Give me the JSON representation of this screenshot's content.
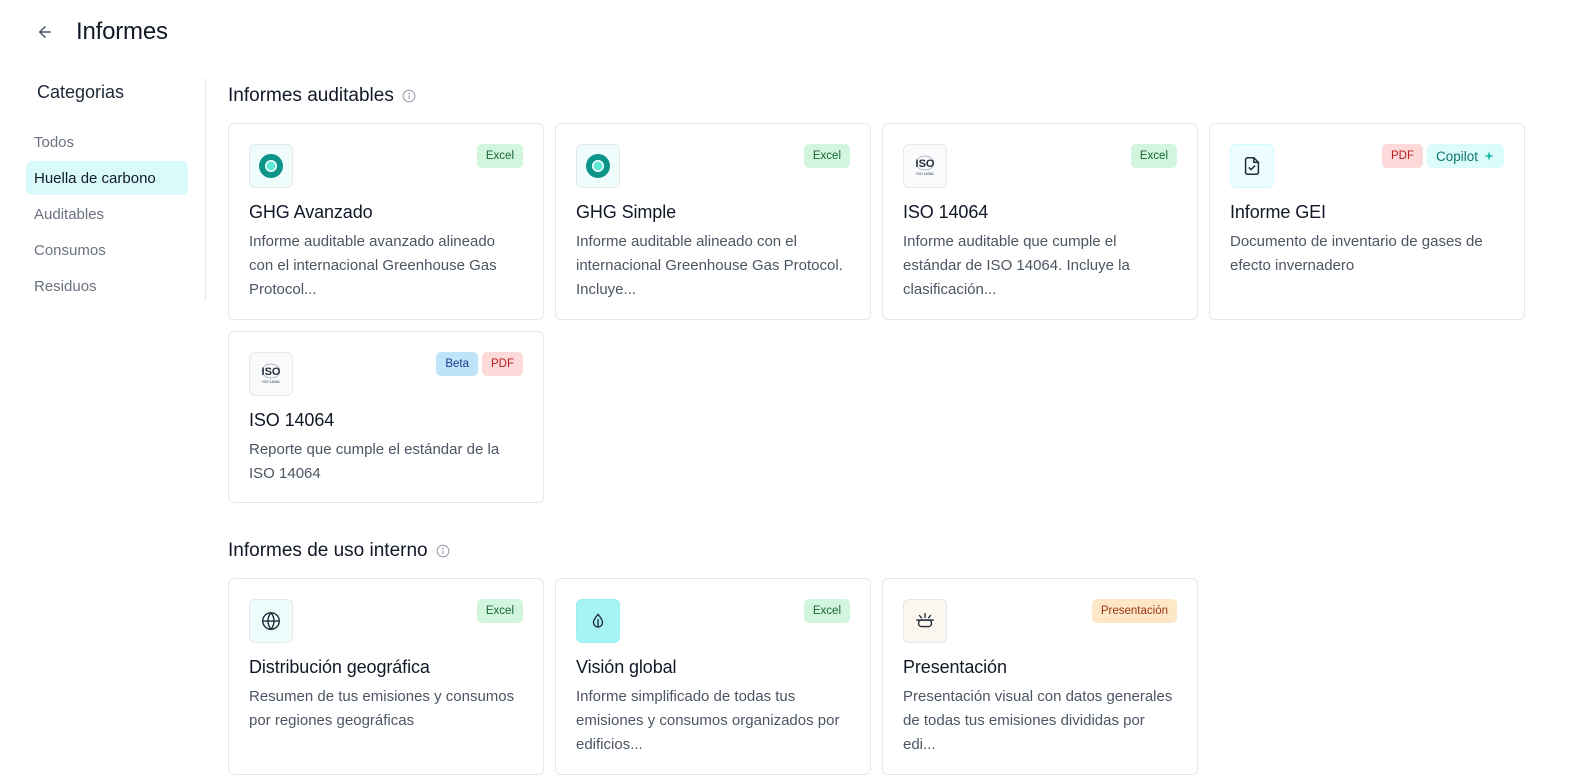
{
  "header": {
    "title": "Informes"
  },
  "sidebar": {
    "title": "Categorias",
    "items": [
      {
        "label": "Todos"
      },
      {
        "label": "Huella de carbono"
      },
      {
        "label": "Auditables"
      },
      {
        "label": "Consumos"
      },
      {
        "label": "Residuos"
      }
    ]
  },
  "sections": [
    {
      "title": "Informes auditables",
      "cards": [
        {
          "icon": "ghg-logo-icon",
          "badges": [
            "Excel"
          ],
          "title": "GHG Avanzado",
          "desc": "Informe auditable avanzado alineado con el internacional Greenhouse Gas Protocol..."
        },
        {
          "icon": "ghg-logo-icon",
          "badges": [
            "Excel"
          ],
          "title": "GHG Simple",
          "desc": "Informe auditable alineado con el internacional Greenhouse Gas Protocol. Incluye..."
        },
        {
          "icon": "iso-logo-icon",
          "badges": [
            "Excel"
          ],
          "title": "ISO 14064",
          "desc": "Informe auditable que cumple el estándar de ISO 14064. Incluye la clasificación..."
        },
        {
          "icon": "file-check-icon",
          "badges": [
            "PDF",
            "Copilot"
          ],
          "title": "Informe GEI",
          "desc": "Documento de inventario de gases de efecto invernadero"
        },
        {
          "icon": "iso-logo-icon",
          "badges": [
            "Beta",
            "PDF"
          ],
          "title": "ISO 14064",
          "desc": "Reporte que cumple el estándar de la ISO 14064"
        }
      ]
    },
    {
      "title": "Informes de uso interno",
      "cards": [
        {
          "icon": "globe-icon",
          "badges": [
            "Excel"
          ],
          "title": "Distribución geográfica",
          "desc": "Resumen de tus emisiones y consumos por regiones geográficas"
        },
        {
          "icon": "leaf-drop-icon",
          "badges": [
            "Excel"
          ],
          "title": "Visión global",
          "desc": "Informe simplificado de todas tus emisiones y consumos organizados por edificios..."
        },
        {
          "icon": "presentation-icon",
          "badges": [
            "Presentación"
          ],
          "title": "Presentación",
          "desc": "Presentación visual con datos generales de todas tus emisiones divididas por edi..."
        }
      ]
    }
  ],
  "iso_logo_text": {
    "big": "ISO",
    "small": "ISO 14064"
  },
  "colors": {
    "accent": "#d9fafa",
    "teal": "#14b8a6",
    "excel": "#d1f5dd",
    "pdf": "#fdd9d9",
    "beta": "#bfe3f8",
    "presentation": "#fde7c7"
  }
}
